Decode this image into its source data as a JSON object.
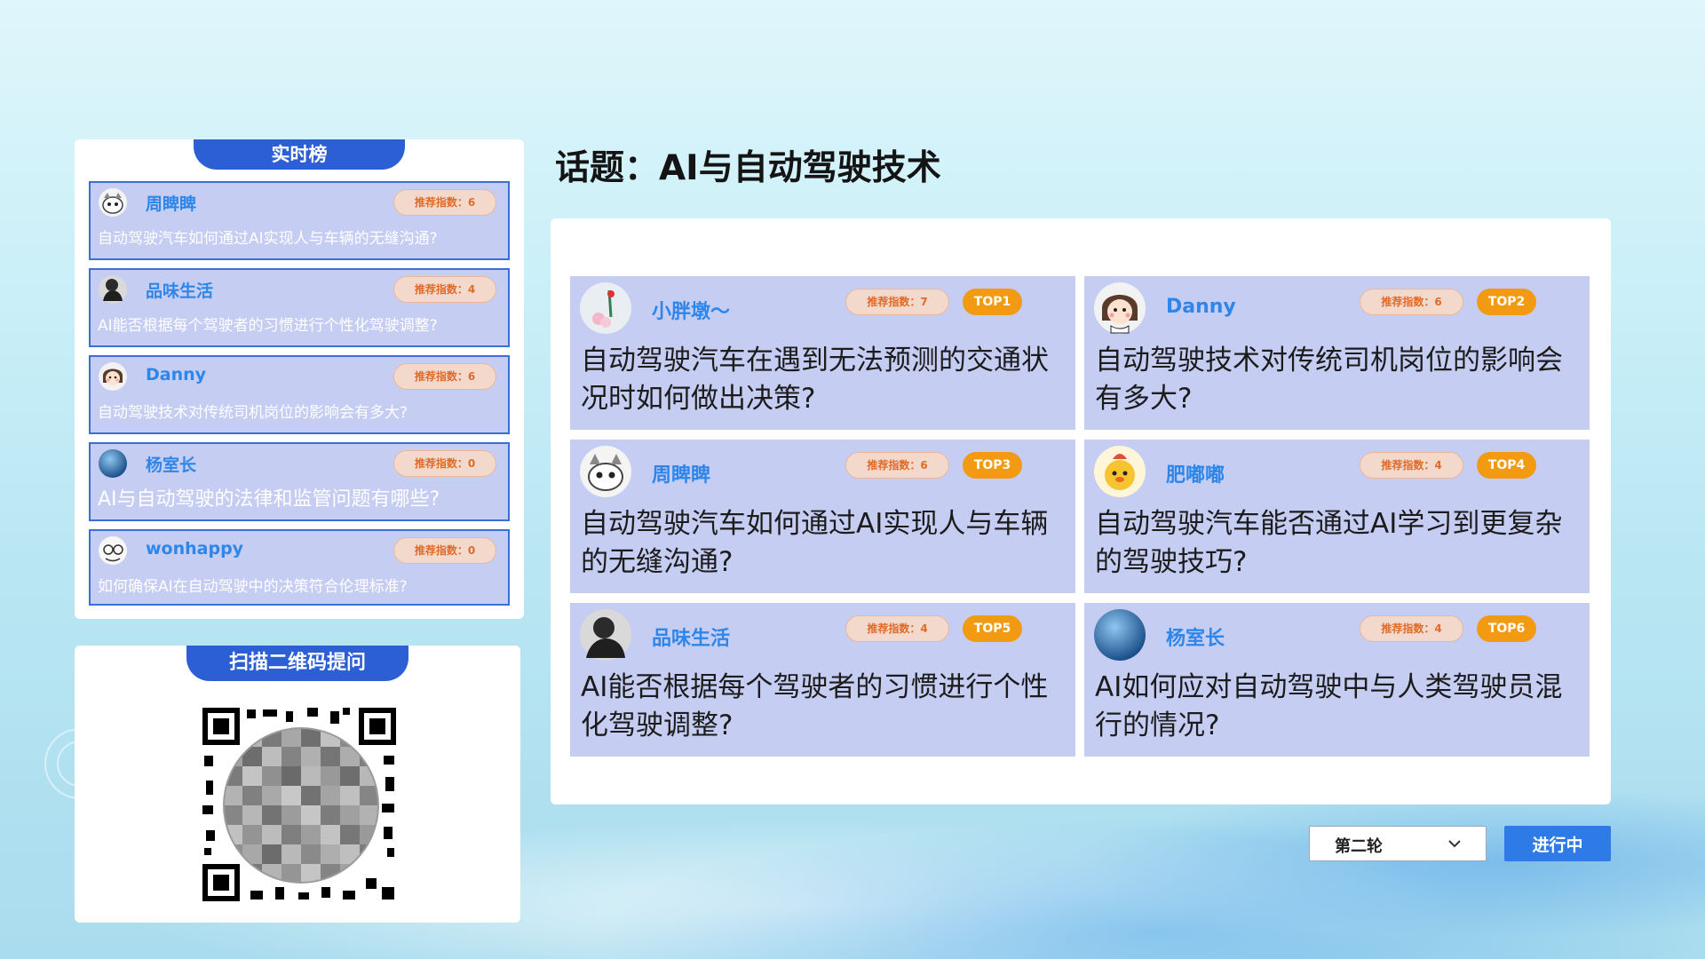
{
  "left_panel": {
    "title": "实时榜",
    "items": [
      {
        "name": "周睥睥",
        "score": "推荐指数：6",
        "question": "自动驾驶汽车如何通过AI实现人与车辆的无缝沟通?",
        "avatar": "cartoon-cat-avatar"
      },
      {
        "name": "品味生活",
        "score": "推荐指数：4",
        "question": "AI能否根据每个驾驶者的习惯进行个性化驾驶调整?",
        "avatar": "dark-portrait-avatar"
      },
      {
        "name": "Danny",
        "score": "推荐指数：6",
        "question": "自动驾驶技术对传统司机岗位的影响会有多大?",
        "avatar": "cartoon-girl-avatar"
      },
      {
        "name": "杨室长",
        "score": "推荐指数：0",
        "question": "AI与自动驾驶的法律和监管问题有哪些?",
        "avatar": "blue-planet-avatar"
      },
      {
        "name": "wonhappy",
        "score": "推荐指数：0",
        "question": "如何确保AI在自动驾驶中的决策符合伦理标准?",
        "avatar": "sketch-avatar"
      }
    ]
  },
  "qr_panel": {
    "title": "扫描二维码提问"
  },
  "topic": {
    "title": "话题：AI与自动驾驶技术"
  },
  "cards": [
    {
      "name": "小胖墩～",
      "score": "推荐指数：7",
      "rank": "TOP1",
      "question": "自动驾驶汽车在遇到无法预测的交通状况时如何做出决策?",
      "avatar": "pink-flower-avatar"
    },
    {
      "name": "Danny",
      "score": "推荐指数：6",
      "rank": "TOP2",
      "question": "自动驾驶技术对传统司机岗位的影响会有多大?",
      "avatar": "cartoon-girl-avatar"
    },
    {
      "name": "周睥睥",
      "score": "推荐指数：6",
      "rank": "TOP3",
      "question": "自动驾驶汽车如何通过AI实现人与车辆的无缝沟通?",
      "avatar": "cartoon-cat-avatar"
    },
    {
      "name": "肥嘟嘟",
      "score": "推荐指数：4",
      "rank": "TOP4",
      "question": "自动驾驶汽车能否通过AI学习到更复杂的驾驶技巧?",
      "avatar": "yellow-duck-avatar"
    },
    {
      "name": "品味生活",
      "score": "推荐指数：4",
      "rank": "TOP5",
      "question": "AI能否根据每个驾驶者的习惯进行个性化驾驶调整?",
      "avatar": "dark-portrait-avatar"
    },
    {
      "name": "杨室长",
      "score": "推荐指数：4",
      "rank": "TOP6",
      "question": "AI如何应对自动驾驶中与人类驾驶员混行的情况?",
      "avatar": "blue-planet-avatar"
    }
  ],
  "controls": {
    "round_selected": "第二轮",
    "status_label": "进行中"
  },
  "colors": {
    "primary": "#2c5fd3",
    "card_bg": "#c6cdf2",
    "username": "#2f86e9",
    "badge_orange": "#f29a12",
    "score_text": "#e06b28"
  }
}
